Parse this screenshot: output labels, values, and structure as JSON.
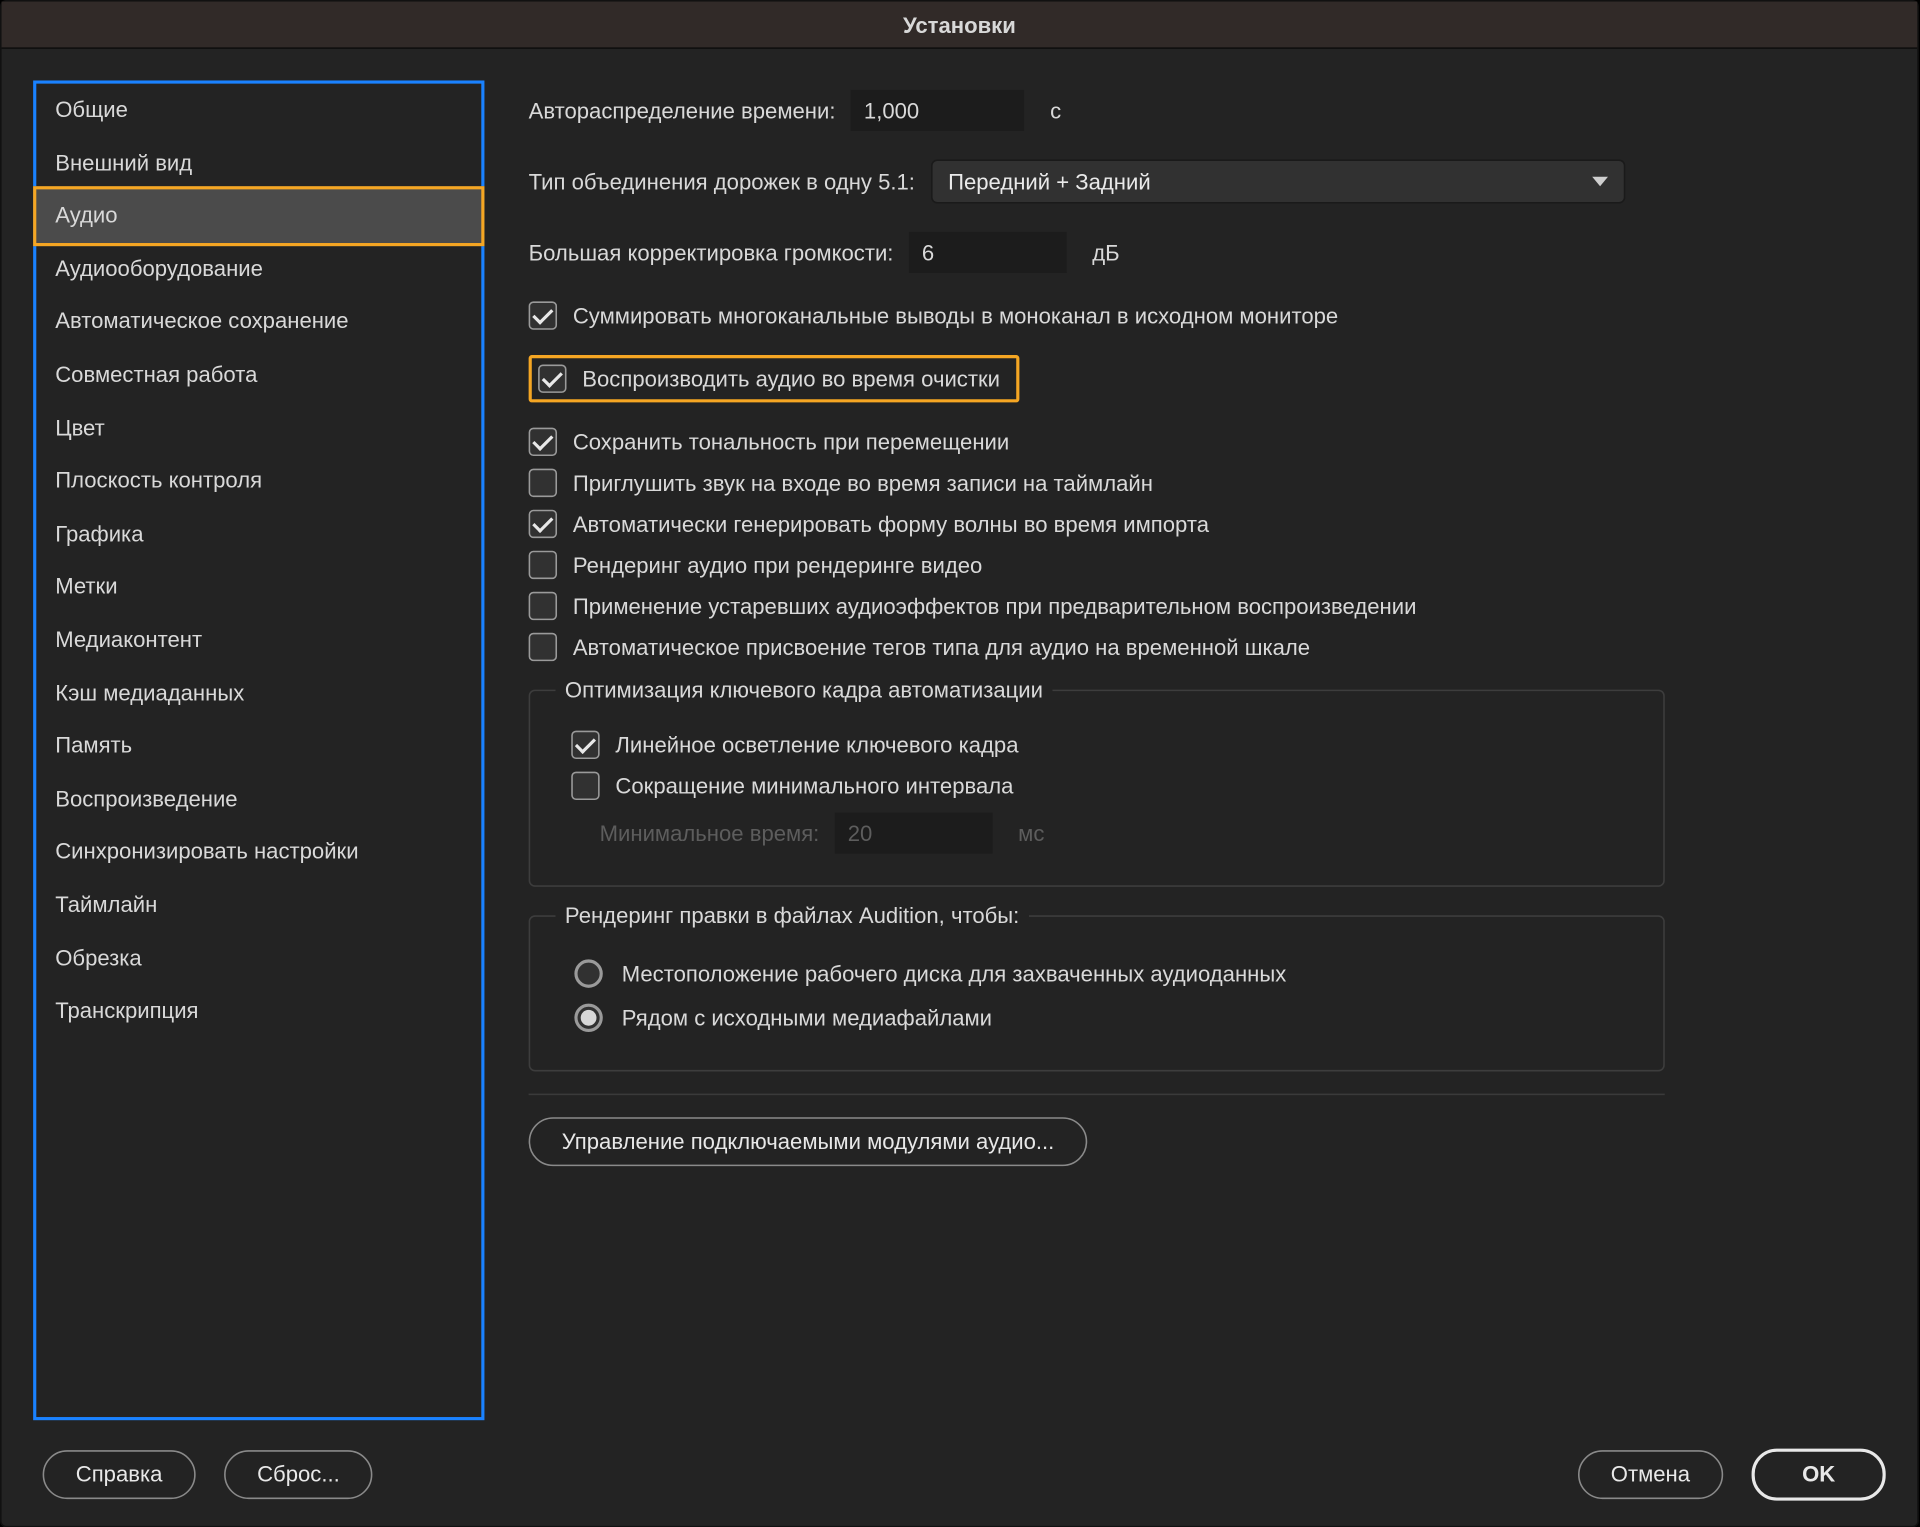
{
  "window": {
    "title": "Установки"
  },
  "sidebar": {
    "items": [
      "Общие",
      "Внешний вид",
      "Аудио",
      "Аудиооборудование",
      "Автоматическое сохранение",
      "Совместная работа",
      "Цвет",
      "Плоскость контроля",
      "Графика",
      "Метки",
      "Медиаконтент",
      "Кэш медиаданных",
      "Память",
      "Воспроизведение",
      "Синхронизировать настройки",
      "Таймлайн",
      "Обрезка",
      "Транскрипция"
    ],
    "selected_index": 2,
    "highlighted_index": 2
  },
  "form": {
    "auto_time_label": "Автораспределение времени:",
    "auto_time_value": "1,000",
    "auto_time_unit": "с",
    "mix_type_label": "Тип объединения дорожек в одну 5.1:",
    "mix_type_selected": "Передний + Задний",
    "large_vol_label": "Большая корректировка громкости:",
    "large_vol_value": "6",
    "large_vol_unit": "дБ",
    "checks": [
      {
        "label": "Суммировать многоканальные выводы в моноканал в исходном мониторе",
        "checked": true,
        "hl": false
      },
      {
        "label": "Воспроизводить аудио во время очистки",
        "checked": true,
        "hl": true
      },
      {
        "label": "Сохранить тональность при перемещении",
        "checked": true,
        "hl": false
      },
      {
        "label": "Приглушить звук на входе во время записи на таймлайн",
        "checked": false,
        "hl": false
      },
      {
        "label": "Автоматически генерировать форму волны во время импорта",
        "checked": true,
        "hl": false
      },
      {
        "label": "Рендеринг аудио при рендеринге видео",
        "checked": false,
        "hl": false
      },
      {
        "label": "Применение устаревших аудиоэффектов при предварительном воспроизведении",
        "checked": false,
        "hl": false
      },
      {
        "label": "Автоматическое присвоение тегов типа для аудио на временной шкале",
        "checked": false,
        "hl": false
      }
    ],
    "group_keyframe": {
      "legend": "Оптимизация ключевого кадра автоматизации",
      "linear": {
        "label": "Линейное осветление ключевого кадра",
        "checked": true
      },
      "reduce": {
        "label": "Сокращение минимального интервала",
        "checked": false
      },
      "min_time_label": "Минимальное время:",
      "min_time_value": "20",
      "min_time_unit": "мс"
    },
    "group_audition": {
      "legend": "Рендеринг правки в файлах Audition, чтобы:",
      "opt1": "Местоположение рабочего диска для захваченных аудиоданных",
      "opt2": "Рядом с исходными медиафайлами",
      "selected": 1
    },
    "plugins_button": "Управление подключаемыми модулями аудио..."
  },
  "footer": {
    "help": "Справка",
    "reset": "Сброс...",
    "cancel": "Отмена",
    "ok": "OK"
  }
}
